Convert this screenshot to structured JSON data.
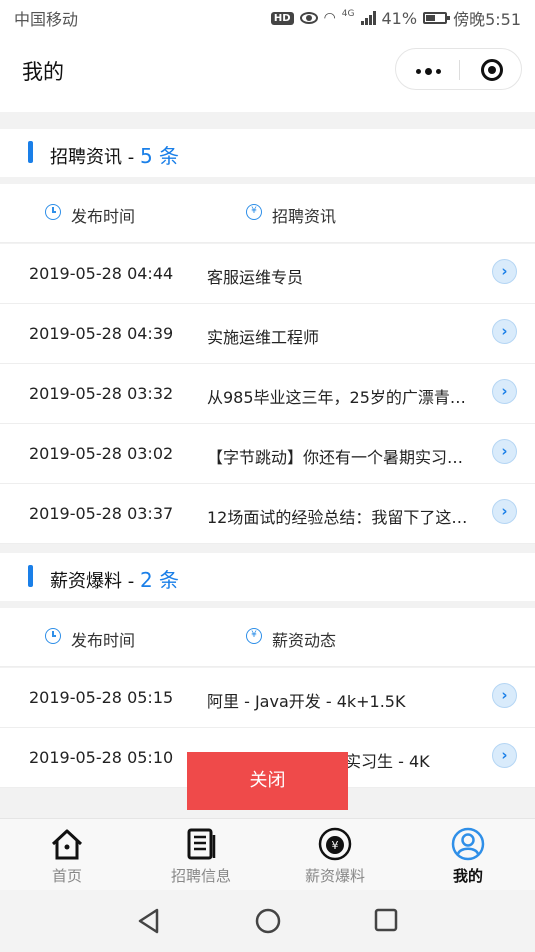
{
  "status_bar": {
    "carrier": "中国移动",
    "hd": "HD",
    "network": "4G",
    "battery": "41%",
    "time": "傍晚5:51"
  },
  "nav": {
    "title": "我的"
  },
  "sections": [
    {
      "title": "招聘资讯 - ",
      "count": "5 条",
      "col_time": "发布时间",
      "col_main": "招聘资讯",
      "rows": [
        {
          "date": "2019-05-28 04:44",
          "title": "客服运维专员"
        },
        {
          "date": "2019-05-28 04:39",
          "title": "实施运维工程师"
        },
        {
          "date": "2019-05-28 03:32",
          "title": "从985毕业这三年，25岁的广漂青…"
        },
        {
          "date": "2019-05-28 03:02",
          "title": "【字节跳动】你还有一个暑期实习…"
        },
        {
          "date": "2019-05-28 03:37",
          "title": "12场面试的经验总结：我留下了这…"
        }
      ]
    },
    {
      "title": "薪资爆料 - ",
      "count": "2 条",
      "col_time": "发布时间",
      "col_main": "薪资动态",
      "rows": [
        {
          "date": "2019-05-28 05:15",
          "title": "阿里 - Java开发 - 4k+1.5K"
        },
        {
          "date": "2019-05-28 05:10",
          "title": "实习生 - 4K"
        }
      ]
    }
  ],
  "close_button": "关闭",
  "tabbar": [
    {
      "label": "首页",
      "icon": "home-icon"
    },
    {
      "label": "招聘信息",
      "icon": "document-icon"
    },
    {
      "label": "薪资爆料",
      "icon": "money-bag-icon"
    },
    {
      "label": "我的",
      "icon": "user-icon",
      "active": true
    }
  ],
  "colors": {
    "accent": "#1a7fe8",
    "close": "#ef4a4a"
  }
}
